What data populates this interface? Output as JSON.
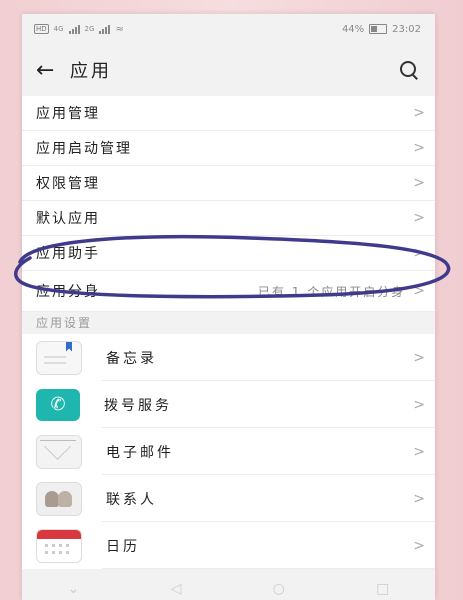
{
  "status_bar": {
    "left_badge": "HD",
    "net1": "4G",
    "net2": "2G",
    "battery_pct": "44%",
    "battery_level": 0.44,
    "time": "23:02"
  },
  "header": {
    "title": "应用"
  },
  "menu": [
    {
      "label": "应用管理",
      "value": ""
    },
    {
      "label": "应用启动管理",
      "value": ""
    },
    {
      "label": "权限管理",
      "value": ""
    },
    {
      "label": "默认应用",
      "value": ""
    },
    {
      "label": "应用助手",
      "value": ""
    },
    {
      "label": "应用分身",
      "value": "已有 1 个应用开启分身"
    }
  ],
  "section_title": "应用设置",
  "apps": [
    {
      "label": "备忘录",
      "icon": "memo-icon"
    },
    {
      "label": "拨号服务",
      "icon": "phone-dial-icon"
    },
    {
      "label": "电子邮件",
      "icon": "mail-icon"
    },
    {
      "label": "联系人",
      "icon": "contacts-icon"
    },
    {
      "label": "日历",
      "icon": "calendar-icon"
    }
  ],
  "chevron": ">",
  "colors": {
    "annotation": "#3f3a8c",
    "dial": "#1fb6b0",
    "calendar": "#d9383f",
    "memo_bookmark": "#2f6fc8"
  }
}
